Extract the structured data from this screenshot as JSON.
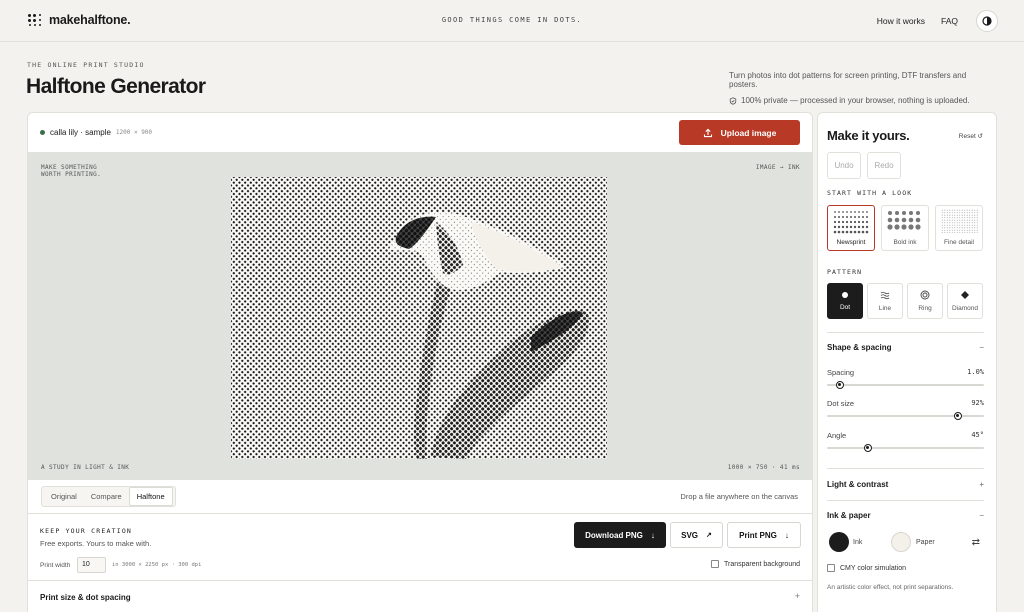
{
  "header": {
    "logo_text": "makehalftone.",
    "tagline": "GOOD THINGS COME IN DOTS.",
    "nav": [
      "How it works",
      "FAQ"
    ]
  },
  "hero": {
    "eyebrow": "THE ONLINE PRINT STUDIO",
    "title": "Halftone Generator",
    "intro": "Turn photos into dot patterns for screen printing, DTF transfers and posters.",
    "privacy": "100% private — processed in your browser, nothing is uploaded."
  },
  "workspace": {
    "file_name": "calla lily · sample",
    "file_dims": "1200 × 900",
    "upload_label": "Upload image",
    "canvas": {
      "top_left": "MAKE SOMETHING\nWORTH PRINTING.",
      "top_right": "IMAGE → INK",
      "bottom_left": "A STUDY IN LIGHT & INK",
      "bottom_right": "1000 × 750 · 41 ms"
    },
    "view_tabs": [
      "Original",
      "Compare",
      "Halftone"
    ],
    "active_view": "Halftone",
    "drop_hint": "Drop a file anywhere on the canvas"
  },
  "export": {
    "title": "KEEP YOUR CREATION",
    "subtitle": "Free exports. Yours to make with.",
    "download_png": "Download PNG",
    "svg": "SVG",
    "print_png": "Print PNG",
    "print_width_label": "Print width",
    "print_width_value": "10",
    "print_width_units": "in  3000 × 2250 px · 300 dpi",
    "transparent_label": "Transparent background",
    "print_size_label": "Print size & dot spacing",
    "print_size_sign": "+"
  },
  "side": {
    "title": "Make it yours.",
    "reset": "Reset ↺",
    "undo": "Undo",
    "redo": "Redo",
    "looks_label": "START WITH A LOOK",
    "looks": [
      "Newsprint",
      "Bold ink",
      "Fine detail"
    ],
    "active_look": "Newsprint",
    "pattern_label": "PATTERN",
    "patterns": [
      "Dot",
      "Line",
      "Ring",
      "Diamond"
    ],
    "active_pattern": "Dot",
    "shape_section": "Shape & spacing",
    "shape_sign": "−",
    "sliders": [
      {
        "label": "Spacing",
        "value": "1.0%",
        "fraction": 0.06
      },
      {
        "label": "Dot size",
        "value": "92%",
        "fraction": 0.85
      },
      {
        "label": "Angle",
        "value": "45°",
        "fraction": 0.25
      }
    ],
    "light_section": "Light & contrast",
    "light_sign": "+",
    "ink_section": "Ink & paper",
    "ink_sign": "−",
    "ink_label": "Ink",
    "paper_label": "Paper",
    "ink_color": "#1c1c1c",
    "paper_color": "#f3f1ea",
    "cmy_label": "CMY color simulation",
    "cmy_note": "An artistic color effect, not print separations."
  },
  "colors": {
    "accent": "#b83a26",
    "dark": "#1c1c1c",
    "background": "#f3f2ee"
  }
}
